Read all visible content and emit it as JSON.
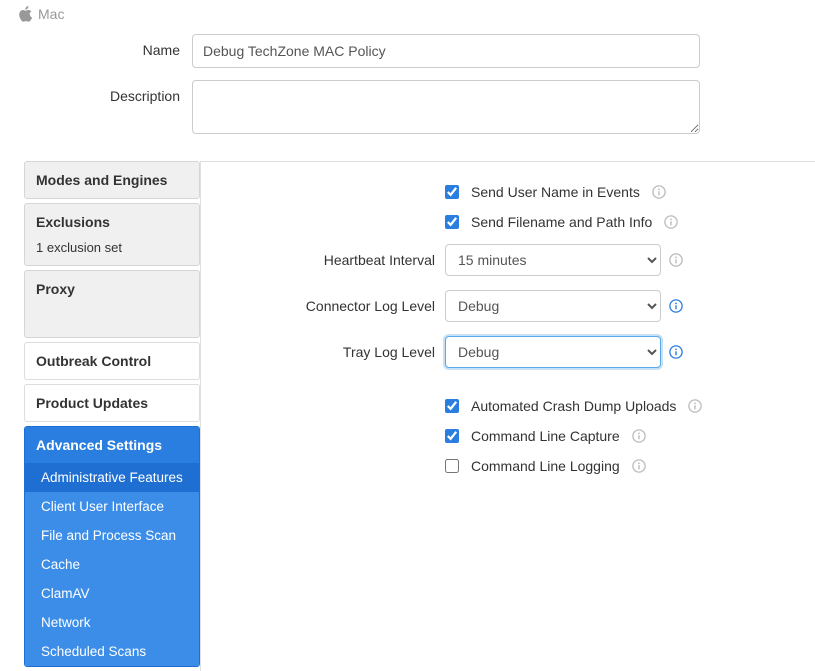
{
  "header": {
    "platform": "Mac"
  },
  "form": {
    "name_label": "Name",
    "name_value": "Debug TechZone MAC Policy",
    "desc_label": "Description",
    "desc_value": ""
  },
  "sidebar": {
    "modes_engines": "Modes and Engines",
    "exclusions": "Exclusions",
    "exclusions_sub": "1 exclusion set",
    "proxy": "Proxy",
    "outbreak": "Outbreak Control",
    "product_updates": "Product Updates",
    "advanced": "Advanced Settings",
    "adv_items": [
      "Administrative Features",
      "Client User Interface",
      "File and Process Scan",
      "Cache",
      "ClamAV",
      "Network",
      "Scheduled Scans"
    ]
  },
  "settings": {
    "send_user_name": {
      "label": "Send User Name in Events",
      "checked": true
    },
    "send_filename": {
      "label": "Send Filename and Path Info",
      "checked": true
    },
    "heartbeat": {
      "label": "Heartbeat Interval",
      "value": "15 minutes"
    },
    "connector_log": {
      "label": "Connector Log Level",
      "value": "Debug"
    },
    "tray_log": {
      "label": "Tray Log Level",
      "value": "Debug"
    },
    "crash_dump": {
      "label": "Automated Crash Dump Uploads",
      "checked": true
    },
    "cmd_capture": {
      "label": "Command Line Capture",
      "checked": true
    },
    "cmd_logging": {
      "label": "Command Line Logging",
      "checked": false
    }
  }
}
